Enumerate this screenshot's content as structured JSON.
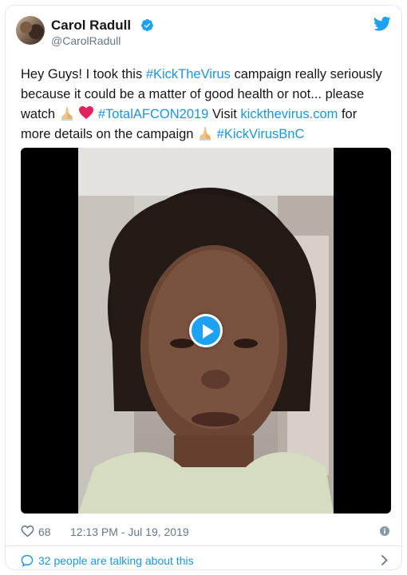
{
  "author": {
    "name": "Carol Radull",
    "handle": "@CarolRadull"
  },
  "tweet": {
    "t1": "Hey Guys! I took this ",
    "hashtag1": "#KickTheVirus",
    "t2": " campaign really seriously because it could be a matter of good health or not... please watch ",
    "hashtag2": "#TotalAFCON2019",
    "t3": "  Visit ",
    "link": "kickthevirus.com",
    "t4": " for more details on the campaign ",
    "hashtag3": "#KickVirusBnC"
  },
  "media": {
    "type": "video",
    "play_icon": "play-icon"
  },
  "meta": {
    "likes": "68",
    "timestamp": "12:13 PM - Jul 19, 2019"
  },
  "conversation": {
    "label": "32 people are talking about this"
  },
  "colors": {
    "link": "#1b95e0",
    "brand": "#1da1f2",
    "muted": "#657786",
    "heart": "#e0245e"
  },
  "icons": [
    "verified-icon",
    "twitter-bird-icon",
    "folded-hands-emoji",
    "red-heart-emoji",
    "heart-icon",
    "info-icon",
    "speech-bubble-icon",
    "chevron-right-icon"
  ]
}
